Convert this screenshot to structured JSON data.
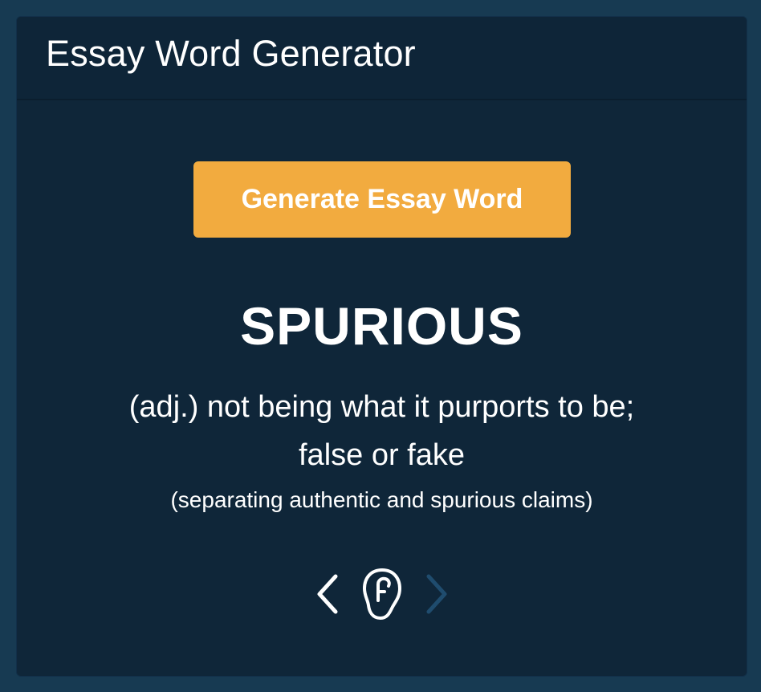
{
  "app": {
    "title": "Essay Word Generator"
  },
  "generate_button": {
    "label": "Generate Essay Word"
  },
  "entry": {
    "word": "SPURIOUS",
    "definition": "(adj.) not being what it purports to be; false or fake",
    "example": "(separating authentic and spurious claims)"
  },
  "controls": {
    "previous_icon": "chevron-left-icon",
    "listen_icon": "ear-icon",
    "next_icon": "chevron-right-icon",
    "next_enabled": false
  },
  "colors": {
    "page_background": "#173a52",
    "card_background": "#0f2639",
    "accent": "#f2ab3f",
    "text": "#ffffff",
    "disabled_icon": "#1f4c6e"
  }
}
